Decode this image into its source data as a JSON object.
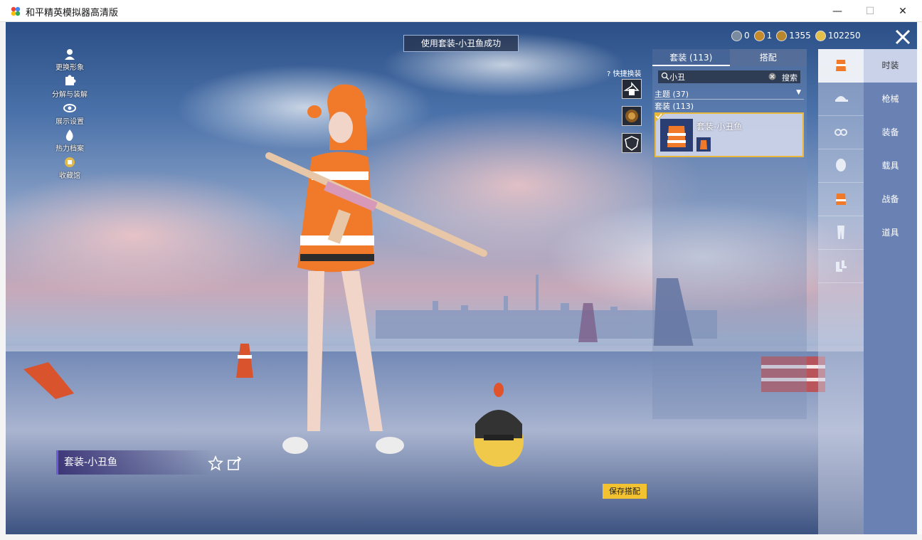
{
  "window": {
    "title": "和平精英模拟器高清版",
    "min_symbol": "—",
    "max_symbol": "☐",
    "close_symbol": "✕"
  },
  "toast": "使用套装-小丑鱼成功",
  "currency": [
    {
      "icon": "coin-icon",
      "value": "0",
      "color": "#7a8aa0"
    },
    {
      "icon": "badge-icon",
      "value": "1",
      "color": "#c48a2c"
    },
    {
      "icon": "bp-coin-icon",
      "value": "1355",
      "color": "#b8862d"
    },
    {
      "icon": "gold-coin-icon",
      "value": "102250",
      "color": "#e2c04a"
    }
  ],
  "left_menu": [
    {
      "name": "change-appearance",
      "icon": "person-icon",
      "label": "更换形象"
    },
    {
      "name": "decompose",
      "icon": "puzzle-icon",
      "label": "分解与装解"
    },
    {
      "name": "display-settings",
      "icon": "eye-icon",
      "label": "展示设置"
    },
    {
      "name": "heat-archive",
      "icon": "flame-icon",
      "label": "热力档案"
    },
    {
      "name": "collection",
      "icon": "cabinet-icon",
      "label": "收藏馆"
    }
  ],
  "quick_change": {
    "label": "快捷换装"
  },
  "panel": {
    "tab_suits": "套装 (113)",
    "tab_match": "搭配",
    "search_value": "小丑",
    "search_button": "搜索",
    "theme_row": "主题 (37)",
    "suit_count": "套装 (113)",
    "selected_item": "套装-小丑鱼"
  },
  "categories": [
    {
      "icon": "outfit-icon"
    },
    {
      "icon": "cap-icon"
    },
    {
      "icon": "goggles-icon"
    },
    {
      "icon": "face-icon"
    },
    {
      "icon": "top-icon"
    },
    {
      "icon": "pants-icon"
    },
    {
      "icon": "shoes-icon"
    }
  ],
  "main_tabs": [
    "时装",
    "枪械",
    "装备",
    "载具",
    "战备",
    "道具"
  ],
  "outfit_name": "套装-小丑鱼",
  "save_button": "保存搭配",
  "colors": {
    "accent_gold": "#f2c230",
    "selected_border": "#e7b83c",
    "tab_bar": "#6a82b3"
  }
}
